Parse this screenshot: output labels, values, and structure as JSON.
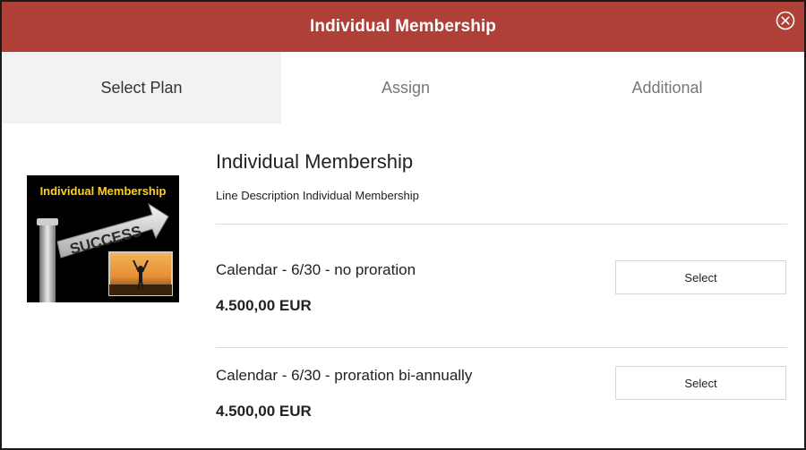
{
  "header": {
    "title": "Individual Membership",
    "background_color": "#ae4038",
    "close_icon": "close-circle-icon"
  },
  "tabs": [
    {
      "label": "Select Plan",
      "active": true
    },
    {
      "label": "Assign",
      "active": false
    },
    {
      "label": "Additional",
      "active": false
    }
  ],
  "product": {
    "title": "Individual Membership",
    "description": "Line Description Individual Membership",
    "image": {
      "banner_text": "Individual Membership",
      "sign_text": "SUCCESS"
    }
  },
  "plans": [
    {
      "name": "Calendar - 6/30 - no proration",
      "price": "4.500,00 EUR",
      "button_label": "Select"
    },
    {
      "name": "Calendar - 6/30 - proration bi-annually",
      "price": "4.500,00 EUR",
      "button_label": "Select"
    }
  ]
}
